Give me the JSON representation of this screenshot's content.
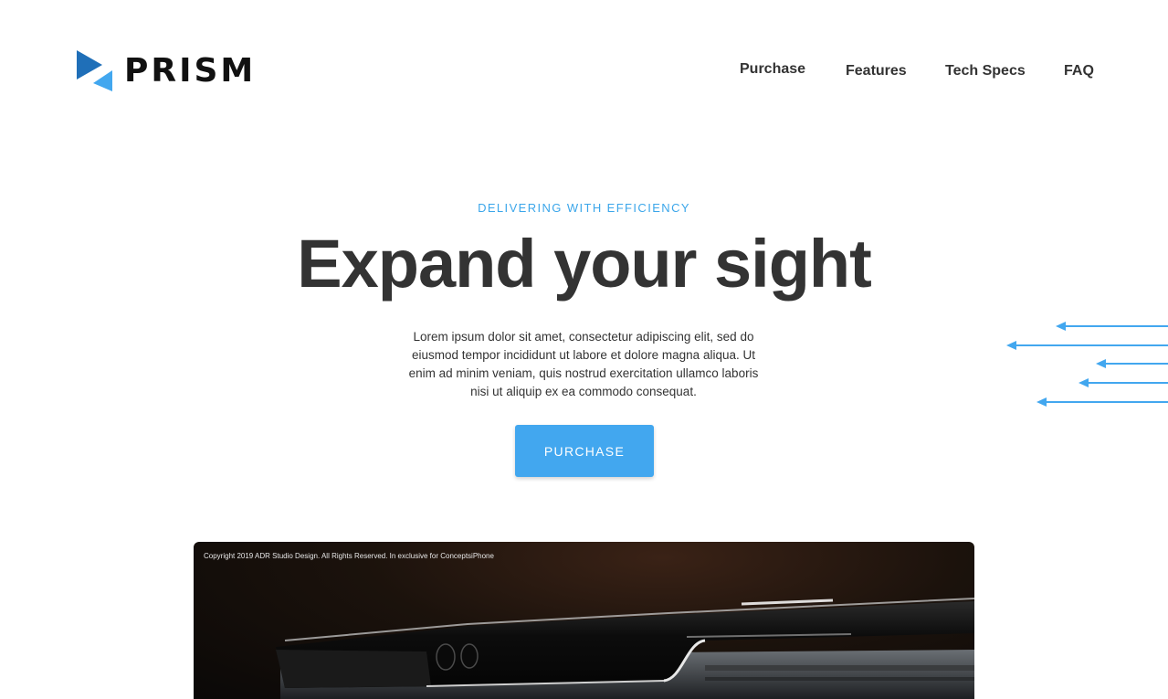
{
  "brand": {
    "name": "PRISM",
    "accent": "#42a7ef",
    "accent_dark": "#1f6fb8"
  },
  "nav": {
    "items": [
      {
        "label": "Purchase"
      },
      {
        "label": "Features"
      },
      {
        "label": "Tech Specs"
      },
      {
        "label": "FAQ"
      }
    ]
  },
  "hero": {
    "eyebrow": "DELIVERING WITH EFFICIENCY",
    "headline": "Expand your sight",
    "body": "Lorem ipsum dolor sit amet, consectetur adipiscing elit, sed do eiusmod tempor incididunt ut labore et dolore magna aliqua. Ut enim ad minim veniam, quis nostrud exercitation ullamco laboris nisi ut aliquip ex ea commodo consequat.",
    "cta_label": "PURCHASE"
  },
  "product_image": {
    "caption": "Copyright 2019 ADR Studio Design. All Rights Reserved. In exclusive for ConceptsiPhone"
  },
  "decorations": {
    "icon": "arrow-left-icon",
    "count": 5
  }
}
